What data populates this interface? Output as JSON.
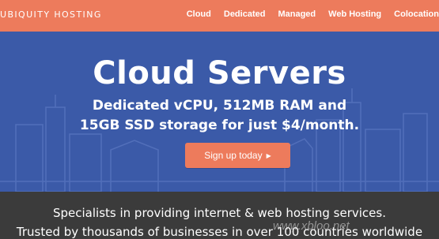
{
  "brand": {
    "logo_text": "UBIQUITY HOSTING"
  },
  "nav": {
    "items": [
      {
        "label": "Cloud"
      },
      {
        "label": "Dedicated"
      },
      {
        "label": "Managed"
      },
      {
        "label": "Web Hosting"
      },
      {
        "label": "Colocation"
      }
    ]
  },
  "hero": {
    "title": "Cloud Servers",
    "subtitle_line1": "Dedicated vCPU, 512MB RAM and",
    "subtitle_line2": "15GB SSD storage for just $4/month.",
    "cta_label": "Sign up today",
    "cta_icon": "caret-right-icon"
  },
  "band": {
    "line1": "Specialists in providing internet & web hosting services.",
    "line2": "Trusted by thousands of businesses in over 100 countries worldwide"
  },
  "watermark": {
    "text": "www.xbloo.net"
  },
  "colors": {
    "nav_bg": "#ed7b5c",
    "hero_bg": "#3b5aa8",
    "cta_bg": "#ed7b5c",
    "band_bg": "#3b3b3b",
    "text": "#ffffff"
  }
}
